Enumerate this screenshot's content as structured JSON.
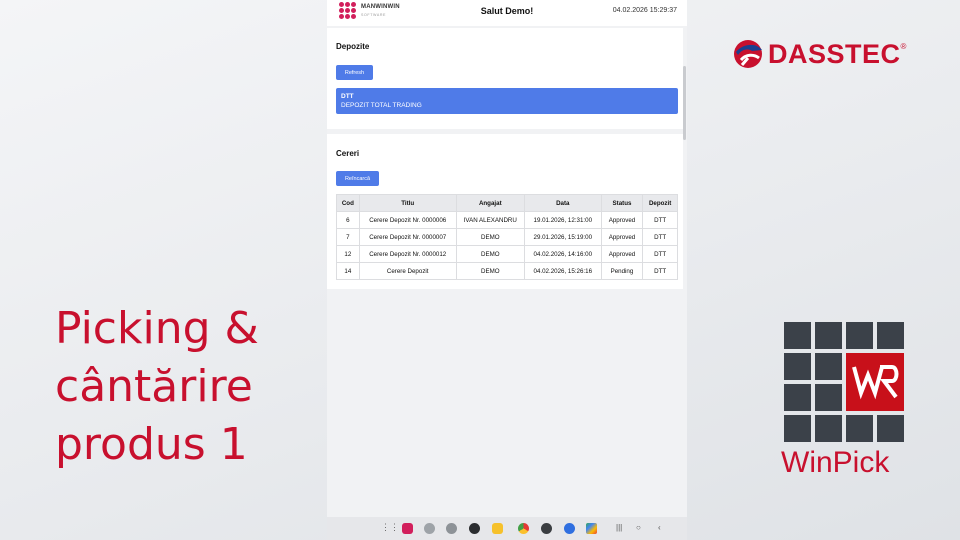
{
  "slide": {
    "caption_lines": [
      "Picking &",
      "cântărire",
      "produs 1"
    ],
    "brand_name": "DASSTEC",
    "brand_reg": "®",
    "product_name": "WinPick",
    "accent_color": "#c8102e"
  },
  "app": {
    "brand": {
      "name": "MANWINWIN",
      "sub": "SOFTWARE"
    },
    "greeting": "Salut Demo!",
    "datetime": "04.02.2026 15:29:37",
    "depozite": {
      "title": "Depozite",
      "refresh_label": "Refresh",
      "selected": {
        "code": "DTT",
        "name": "DEPOZIT TOTAL TRADING"
      }
    },
    "cereri": {
      "title": "Cereri",
      "reload_label": "Reîncarcă",
      "columns": [
        "Cod",
        "Titlu",
        "Angajat",
        "Data",
        "Status",
        "Depozit"
      ],
      "rows": [
        [
          "6",
          "Cerere Depozit Nr. 0000006",
          "IVAN ALEXANDRU",
          "19.01.2026, 12:31:00",
          "Approved",
          "DTT"
        ],
        [
          "7",
          "Cerere Depozit Nr. 0000007",
          "DEMO",
          "29.01.2026, 15:19:00",
          "Approved",
          "DTT"
        ],
        [
          "12",
          "Cerere Depozit Nr. 0000012",
          "DEMO",
          "04.02.2026, 14:16:00",
          "Approved",
          "DTT"
        ],
        [
          "14",
          "Cerere Depozit",
          "DEMO",
          "04.02.2026, 15:26:16",
          "Pending",
          "DTT"
        ]
      ]
    },
    "primary_color": "#4f7be8"
  },
  "taskbar": {
    "apps": [
      "apps-grid-icon",
      "manwinwin-icon",
      "app-icon-1",
      "app-icon-2",
      "camera-icon",
      "notes-icon",
      "chrome-icon",
      "settings-icon",
      "messages-icon",
      "play-store-icon"
    ]
  }
}
